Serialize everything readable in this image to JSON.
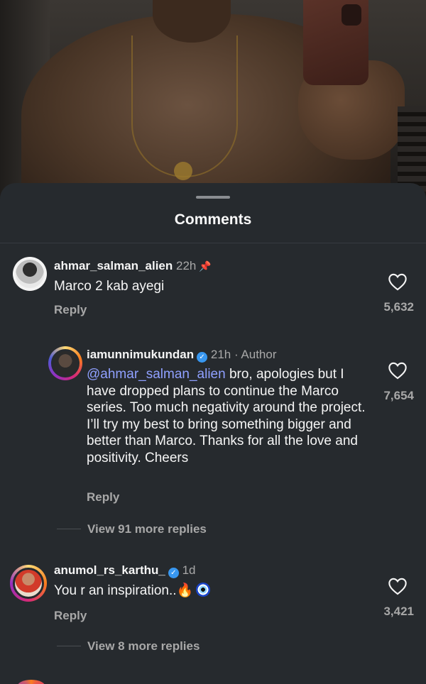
{
  "sheet": {
    "title": "Comments"
  },
  "comments": [
    {
      "username": "ahmar_salman_alien",
      "time": "22h",
      "pinned_icon": "pin-icon",
      "text": "Marco 2 kab ayegi",
      "reply_label": "Reply",
      "likes": "5,632"
    },
    {
      "username": "iamunnimukundan",
      "verified": true,
      "time": "21h",
      "author_tag": "· Author",
      "mention": "@ahmar_salman_alien",
      "text": " bro, apologies but I have dropped plans to continue the Marco series. Too much negativity around the project. I’ll try my best to bring something bigger and better than Marco. Thanks for all the love and positivity. Cheers",
      "reply_label": "Reply",
      "likes": "7,654",
      "view_more": "View 91 more replies"
    },
    {
      "username": "anumol_rs_karthu_",
      "verified": true,
      "time": "1d",
      "text": "You r an inspiration..",
      "emoji": [
        "🔥",
        "nazar-amulet-icon"
      ],
      "reply_label": "Reply",
      "likes": "3,421",
      "view_more": "View 8 more replies"
    }
  ],
  "colors": {
    "sheet_bg": "#262a2e",
    "mention": "#8fa0ff",
    "verified": "#3897f0",
    "secondary_text": "#a8a8a8"
  }
}
